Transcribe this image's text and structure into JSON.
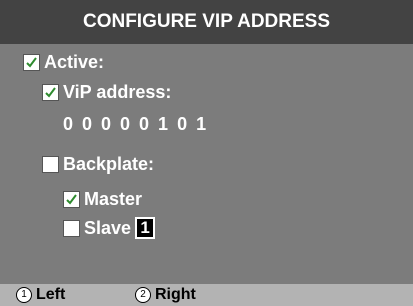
{
  "title": "CONFIGURE VIP ADDRESS",
  "active": {
    "label": "Active:",
    "checked": true
  },
  "vip_address": {
    "label": "ViP address:",
    "checked": true,
    "value": "0 0 0 0 0 1 0 1"
  },
  "backplate": {
    "label": "Backplate:",
    "checked": false
  },
  "master": {
    "label": "Master",
    "checked": true
  },
  "slave": {
    "label": "Slave",
    "checked": false,
    "value": "1"
  },
  "footer": {
    "left": {
      "number": "1",
      "label": "Left"
    },
    "right": {
      "number": "2",
      "label": "Right"
    }
  },
  "colors": {
    "header_bg": "#434343",
    "panel_bg": "#7c7c7c",
    "footer_bg": "#b3b3b3",
    "check": "#2e8b2e"
  }
}
